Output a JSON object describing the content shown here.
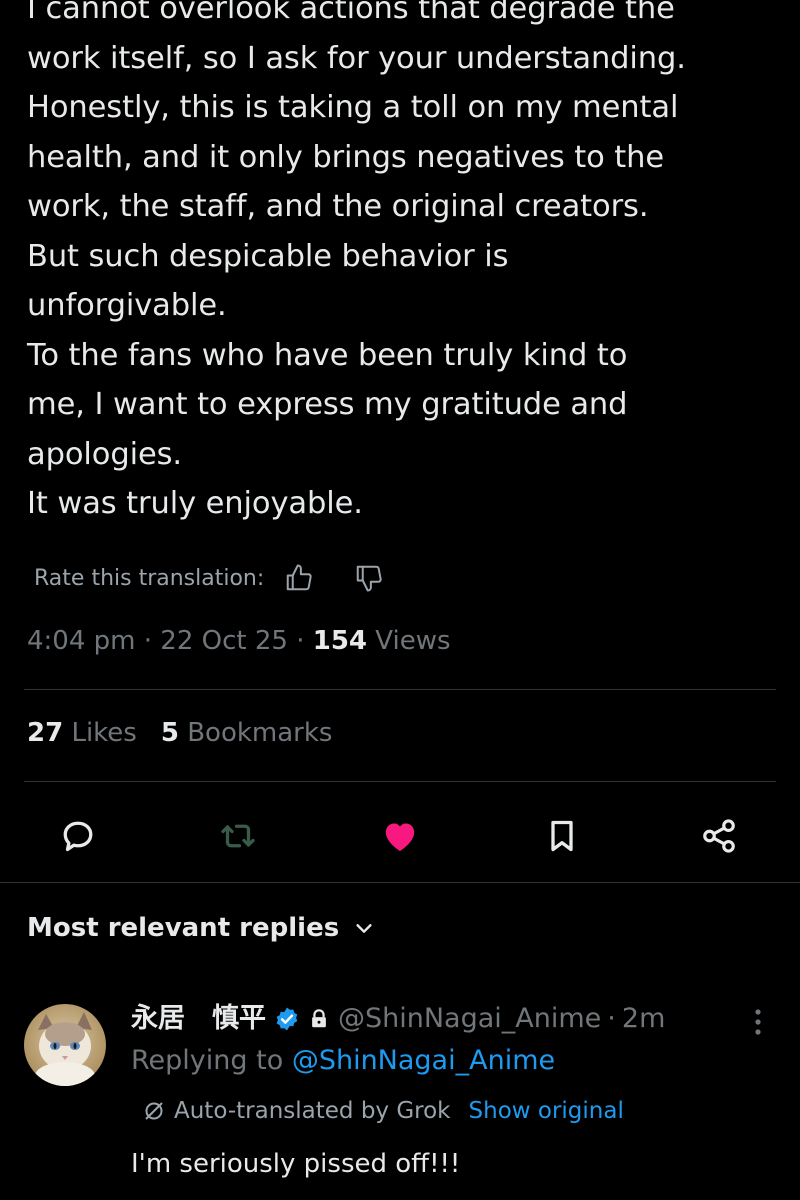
{
  "tweet": {
    "text": "I cannot overlook actions that degrade the\nwork itself, so I ask for your understanding.\nHonestly, this is taking a toll on my mental\nhealth, and it only brings negatives to the\nwork, the staff, and the original creators.\nBut such despicable behavior is\nunforgivable.\nTo the fans who have been truly kind to\nme, I want to express my gratitude and\napologies.\nIt was truly enjoyable.",
    "rate_label": "Rate this translation:",
    "rate_up_icon": "thumbs-up-icon",
    "rate_down_icon": "thumbs-down-icon",
    "time": "4:04 pm",
    "sep": "·",
    "date": "22 Oct 25",
    "views_count": "154",
    "views_label": "Views"
  },
  "stats": {
    "likes_count": "27",
    "likes_label": "Likes",
    "bookmarks_count": "5",
    "bookmarks_label": "Bookmarks"
  },
  "actions": {
    "reply_icon": "reply-icon",
    "retweet_icon": "retweet-icon",
    "like_icon": "heart-filled-icon",
    "bookmark_icon": "bookmark-icon",
    "share_icon": "share-icon",
    "like_color": "#f91880",
    "icon_color": "#9ba3ab",
    "retweet_disabled_color": "#3a5a4a"
  },
  "replies": {
    "header": "Most relevant replies",
    "items": [
      {
        "name": "永居　慎平",
        "handle": "@ShinNagai_Anime",
        "sep": "·",
        "time": "2m",
        "replying_prefix": "Replying to",
        "replying_handle": "@ShinNagai_Anime",
        "auto_translated": "Auto-translated by Grok",
        "show_original": "Show original",
        "text": "I'm seriously pissed off!!!"
      }
    ]
  },
  "colors": {
    "background": "#000000",
    "text_primary": "#e7e9ea",
    "text_secondary": "#71767b",
    "accent": "#1d9bf0",
    "divider": "#2f3336"
  }
}
